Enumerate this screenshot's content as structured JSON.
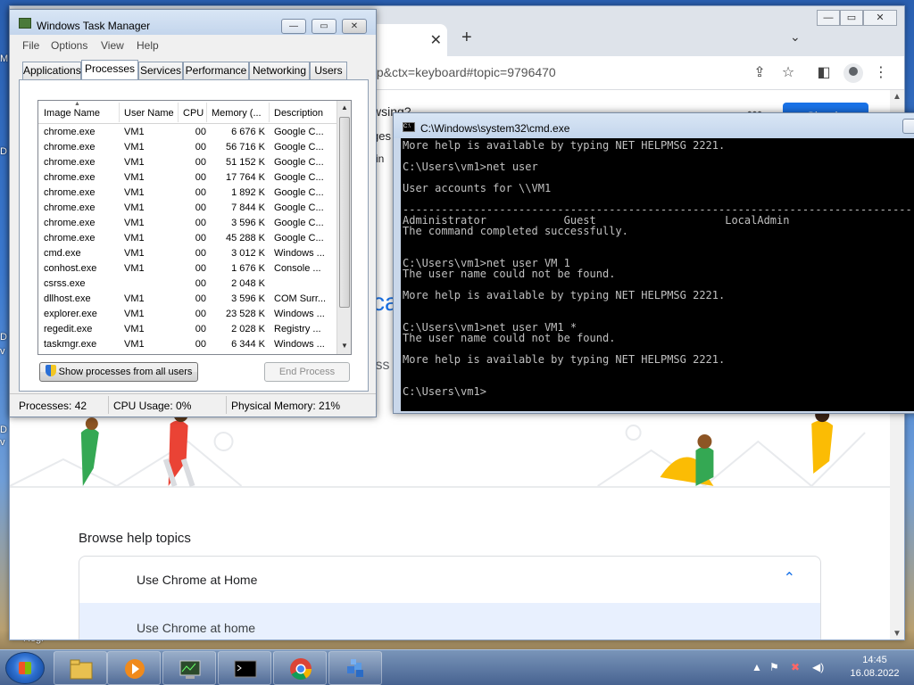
{
  "desktop": {
    "labels": [
      "M",
      "D",
      "D",
      "v",
      "D",
      "v",
      "Regi"
    ]
  },
  "chrome": {
    "url": "elp&ctx=keyboard#topic=9796470",
    "fragments": [
      "wsing?",
      "ges",
      "in",
      "ca",
      "iss"
    ],
    "sign_in_label": "Sign in",
    "browse_title": "Browse help topics",
    "accordion_title": "Use Chrome at Home",
    "accordion_item": "Use Chrome at home"
  },
  "taskmgr": {
    "title": "Windows Task Manager",
    "menu": [
      "File",
      "Options",
      "View",
      "Help"
    ],
    "tabs": [
      "Applications",
      "Processes",
      "Services",
      "Performance",
      "Networking",
      "Users"
    ],
    "active_tab": "Processes",
    "columns": [
      "Image Name",
      "User Name",
      "CPU",
      "Memory (...",
      "Description"
    ],
    "rows": [
      [
        "chrome.exe",
        "VM1",
        "00",
        "6 676 K",
        "Google C..."
      ],
      [
        "chrome.exe",
        "VM1",
        "00",
        "56 716 K",
        "Google C..."
      ],
      [
        "chrome.exe",
        "VM1",
        "00",
        "51 152 K",
        "Google C..."
      ],
      [
        "chrome.exe",
        "VM1",
        "00",
        "17 764 K",
        "Google C..."
      ],
      [
        "chrome.exe",
        "VM1",
        "00",
        "1 892 K",
        "Google C..."
      ],
      [
        "chrome.exe",
        "VM1",
        "00",
        "7 844 K",
        "Google C..."
      ],
      [
        "chrome.exe",
        "VM1",
        "00",
        "3 596 K",
        "Google C..."
      ],
      [
        "chrome.exe",
        "VM1",
        "00",
        "45 288 K",
        "Google C..."
      ],
      [
        "cmd.exe",
        "VM1",
        "00",
        "3 012 K",
        "Windows ..."
      ],
      [
        "conhost.exe",
        "VM1",
        "00",
        "1 676 K",
        "Console ..."
      ],
      [
        "csrss.exe",
        "",
        "00",
        "2 048 K",
        ""
      ],
      [
        "dllhost.exe",
        "VM1",
        "00",
        "3 596 K",
        "COM Surr..."
      ],
      [
        "explorer.exe",
        "VM1",
        "00",
        "23 528 K",
        "Windows ..."
      ],
      [
        "regedit.exe",
        "VM1",
        "00",
        "2 028 K",
        "Registry ..."
      ],
      [
        "taskmgr.exe",
        "VM1",
        "00",
        "6 344 K",
        "Windows ..."
      ]
    ],
    "show_all_button": "Show processes from all users",
    "end_process_button": "End Process",
    "status": {
      "processes": "Processes: 42",
      "cpu": "CPU Usage: 0%",
      "memory": "Physical Memory: 21%"
    }
  },
  "cmd": {
    "title": "C:\\Windows\\system32\\cmd.exe",
    "lines": [
      "More help is available by typing NET HELPMSG 2221.",
      "",
      "C:\\Users\\vm1>net user",
      "",
      "User accounts for \\\\VM1",
      "",
      "-------------------------------------------------------------------------------",
      "Administrator            Guest                    LocalAdmin",
      "The command completed successfully.",
      "",
      "",
      "C:\\Users\\vm1>net user VM 1",
      "The user name could not be found.",
      "",
      "More help is available by typing NET HELPMSG 2221.",
      "",
      "",
      "C:\\Users\\vm1>net user VM1 *",
      "The user name could not be found.",
      "",
      "More help is available by typing NET HELPMSG 2221.",
      "",
      "",
      "C:\\Users\\vm1>"
    ]
  },
  "taskbar": {
    "time": "14:45",
    "date": "16.08.2022"
  }
}
